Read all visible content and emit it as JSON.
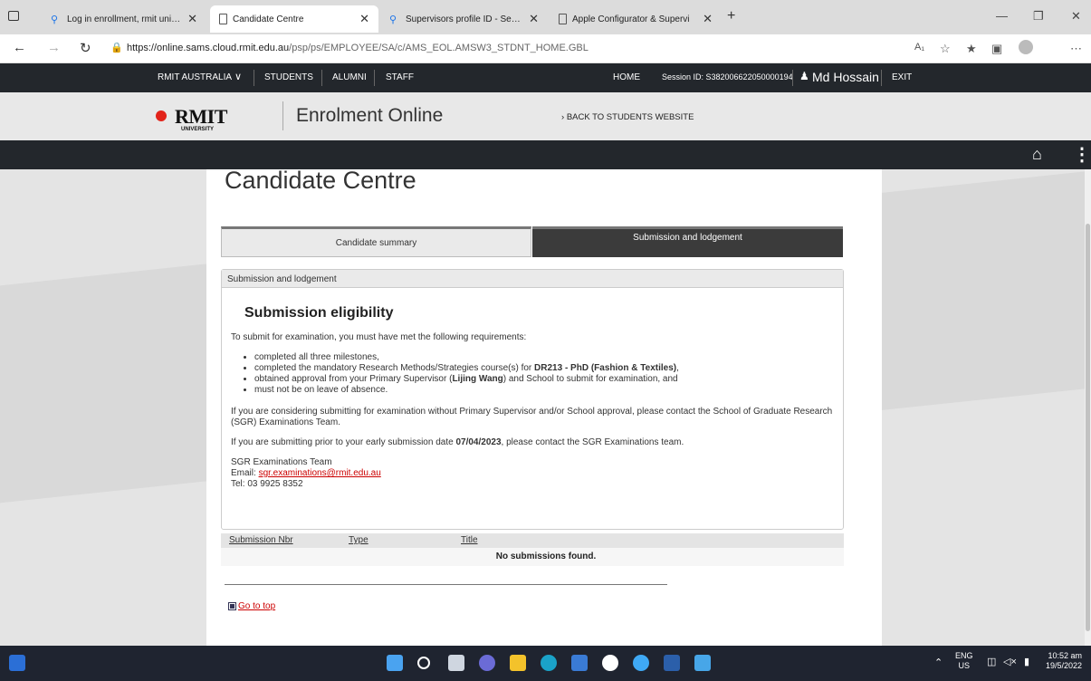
{
  "browser": {
    "tabs": [
      {
        "label": "Log in enrollment, rmit universit"
      },
      {
        "label": "Candidate Centre"
      },
      {
        "label": "Supervisors profile ID - Search"
      },
      {
        "label": "Apple Configurator & Supervi"
      }
    ],
    "url_host": "https://online.sams.cloud.rmit.edu.au",
    "url_path": "/psp/ps/EMPLOYEE/SA/c/AMS_EOL.AMSW3_STDNT_HOME.GBL"
  },
  "topnav": {
    "rmit_australia": "RMIT AUSTRALIA",
    "students": "STUDENTS",
    "alumni": "ALUMNI",
    "staff": "STAFF",
    "home": "HOME",
    "session": "Session ID: S3820066220500001​94",
    "user": "Md Hossain",
    "exit": "EXIT"
  },
  "header": {
    "logo": "RMIT",
    "logo_sub": "UNIVERSITY",
    "title": "Enrolment Online",
    "back_link": "BACK TO STUDENTS WEBSITE"
  },
  "page": {
    "title": "Candidate Centre",
    "tab_summary": "Candidate summary",
    "tab_submission": "Submission and lodgement",
    "section_header": "Submission and lodgement",
    "heading": "Submission eligibility",
    "intro": "To submit for examination, you must have met the following requirements:",
    "req1": "completed all three milestones,",
    "req2_pre": "completed the mandatory Research Methods/Strategies course(s) for ",
    "req2_bold": "DR213 - PhD (Fashion & Textiles)",
    "req2_post": ",",
    "req3_pre": "obtained approval from your Primary Supervisor (",
    "req3_bold": "Lijing Wang",
    "req3_post": ") and School to submit for examination, and",
    "req4": "must not be on leave of absence.",
    "para1": "If you are considering submitting for examination without Primary Supervisor and/or School approval, please contact the School of Graduate Research (SGR) Examinations Team.",
    "para2_pre": "If you are submitting prior to your early submission date ",
    "para2_bold": "07/04/2023",
    "para2_post": ", please contact the SGR Examinations team.",
    "team": "SGR Examinations Team",
    "email_label": "Email: ",
    "email": "sgr.examinations@rmit.edu.au",
    "tel": "Tel: 03 9925 8352",
    "col_nbr": "Submission Nbr",
    "col_type": "Type",
    "col_title": "Title",
    "empty": "No submissions found.",
    "go_top": "Go to top"
  },
  "taskbar": {
    "lang": "ENG",
    "region": "US",
    "time": "10:52 am",
    "date": "19/5/2022"
  },
  "colors": {
    "rmit_red": "#e2231a",
    "dark_bar": "#23272c",
    "taskbar": "#1f2430"
  }
}
